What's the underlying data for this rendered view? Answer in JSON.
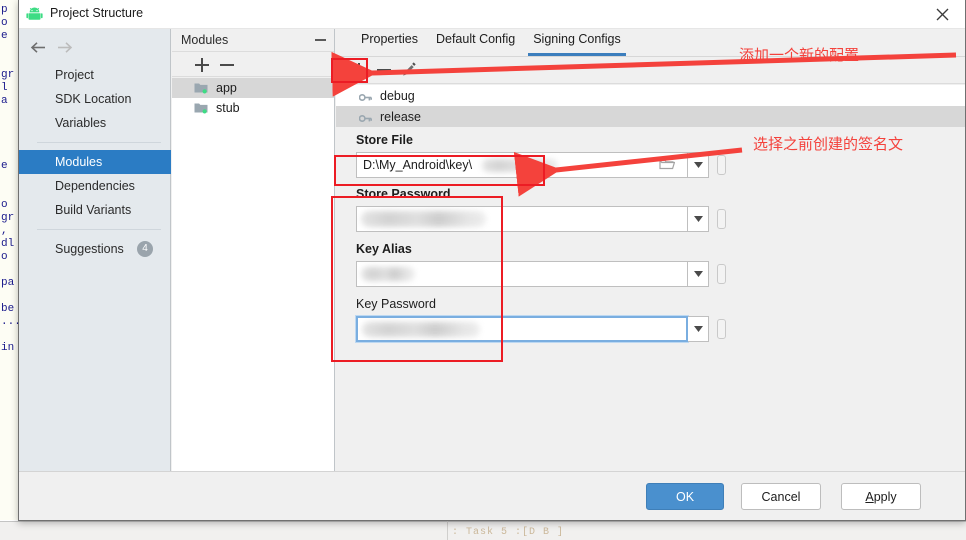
{
  "window": {
    "title": "Project Structure",
    "icon": "android-robot-icon",
    "close_label": "✕"
  },
  "background": {
    "gutter_code": "p\no\ne\n\n\ngr\nl\na\n\n\n\n\ne\n\n\no\ngr\n,\ndl\no\n\npa\n\nbe\n...\n\nin",
    "status_text": ": Task             5 :[D  B ]"
  },
  "nav": {
    "back_icon": "arrow-left-icon",
    "forward_icon": "arrow-right-icon",
    "groups": [
      {
        "items": [
          {
            "label": "Project",
            "selected": false
          },
          {
            "label": "SDK Location",
            "selected": false
          },
          {
            "label": "Variables",
            "selected": false
          }
        ]
      },
      {
        "items": [
          {
            "label": "Modules",
            "selected": true
          },
          {
            "label": "Dependencies",
            "selected": false
          },
          {
            "label": "Build Variants",
            "selected": false
          }
        ]
      },
      {
        "items": [
          {
            "label": "Suggestions",
            "selected": false,
            "badge": "4"
          }
        ]
      }
    ]
  },
  "modules_panel": {
    "header": "Modules",
    "collapse_icon": "minimize-icon",
    "toolbar": {
      "add_icon": "plus-icon",
      "remove_icon": "minus-icon"
    },
    "tree": [
      {
        "label": "app",
        "icon": "module-folder-icon",
        "selected": true
      },
      {
        "label": "stub",
        "icon": "module-folder-icon",
        "selected": false
      }
    ]
  },
  "main": {
    "tabs": [
      {
        "label": "Properties",
        "active": false
      },
      {
        "label": "Default Config",
        "active": false
      },
      {
        "label": "Signing Configs",
        "active": true
      }
    ],
    "toolbar": {
      "add_icon": "plus-icon",
      "remove_icon": "minus-icon",
      "edit_icon": "pencil-icon"
    },
    "signing_configs": [
      {
        "label": "debug",
        "icon": "key-icon",
        "selected": false
      },
      {
        "label": "release",
        "icon": "key-icon",
        "selected": true
      }
    ],
    "fields": [
      {
        "label": "Store File",
        "bold": true,
        "value": "D:\\My_Android\\key\\",
        "masked": true,
        "has_folder_button": true,
        "folder_icon": "folder-open-icon",
        "dropdown_icon": "chevron-down-icon",
        "variable_icon": "variable-button-icon",
        "focused": false
      },
      {
        "label": "Store Password",
        "bold": true,
        "value": "",
        "masked": true,
        "has_folder_button": false,
        "dropdown_icon": "chevron-down-icon",
        "variable_icon": "variable-button-icon",
        "focused": false
      },
      {
        "label": "Key Alias",
        "bold": true,
        "value": "",
        "masked": true,
        "has_folder_button": false,
        "dropdown_icon": "chevron-down-icon",
        "variable_icon": "variable-button-icon",
        "focused": false
      },
      {
        "label": "Key Password",
        "bold": false,
        "value": "",
        "masked": true,
        "has_folder_button": false,
        "dropdown_icon": "chevron-down-icon",
        "variable_icon": "variable-button-icon",
        "focused": true
      }
    ]
  },
  "annotations": [
    {
      "text": "添加一个新的配置",
      "kind": "arrow-label"
    },
    {
      "text": "选择之前创建的签名文",
      "kind": "arrow-label"
    }
  ],
  "footer": {
    "ok": "OK",
    "cancel": "Cancel",
    "apply_prefix": "A",
    "apply_rest": "pply"
  },
  "colors": {
    "selection_blue": "#2b7cc4",
    "accent_tab": "#3c7ebd",
    "annotation_red": "#ec1c24",
    "annotation_text_red": "#f4423c",
    "ok_button": "#4a90ce"
  }
}
